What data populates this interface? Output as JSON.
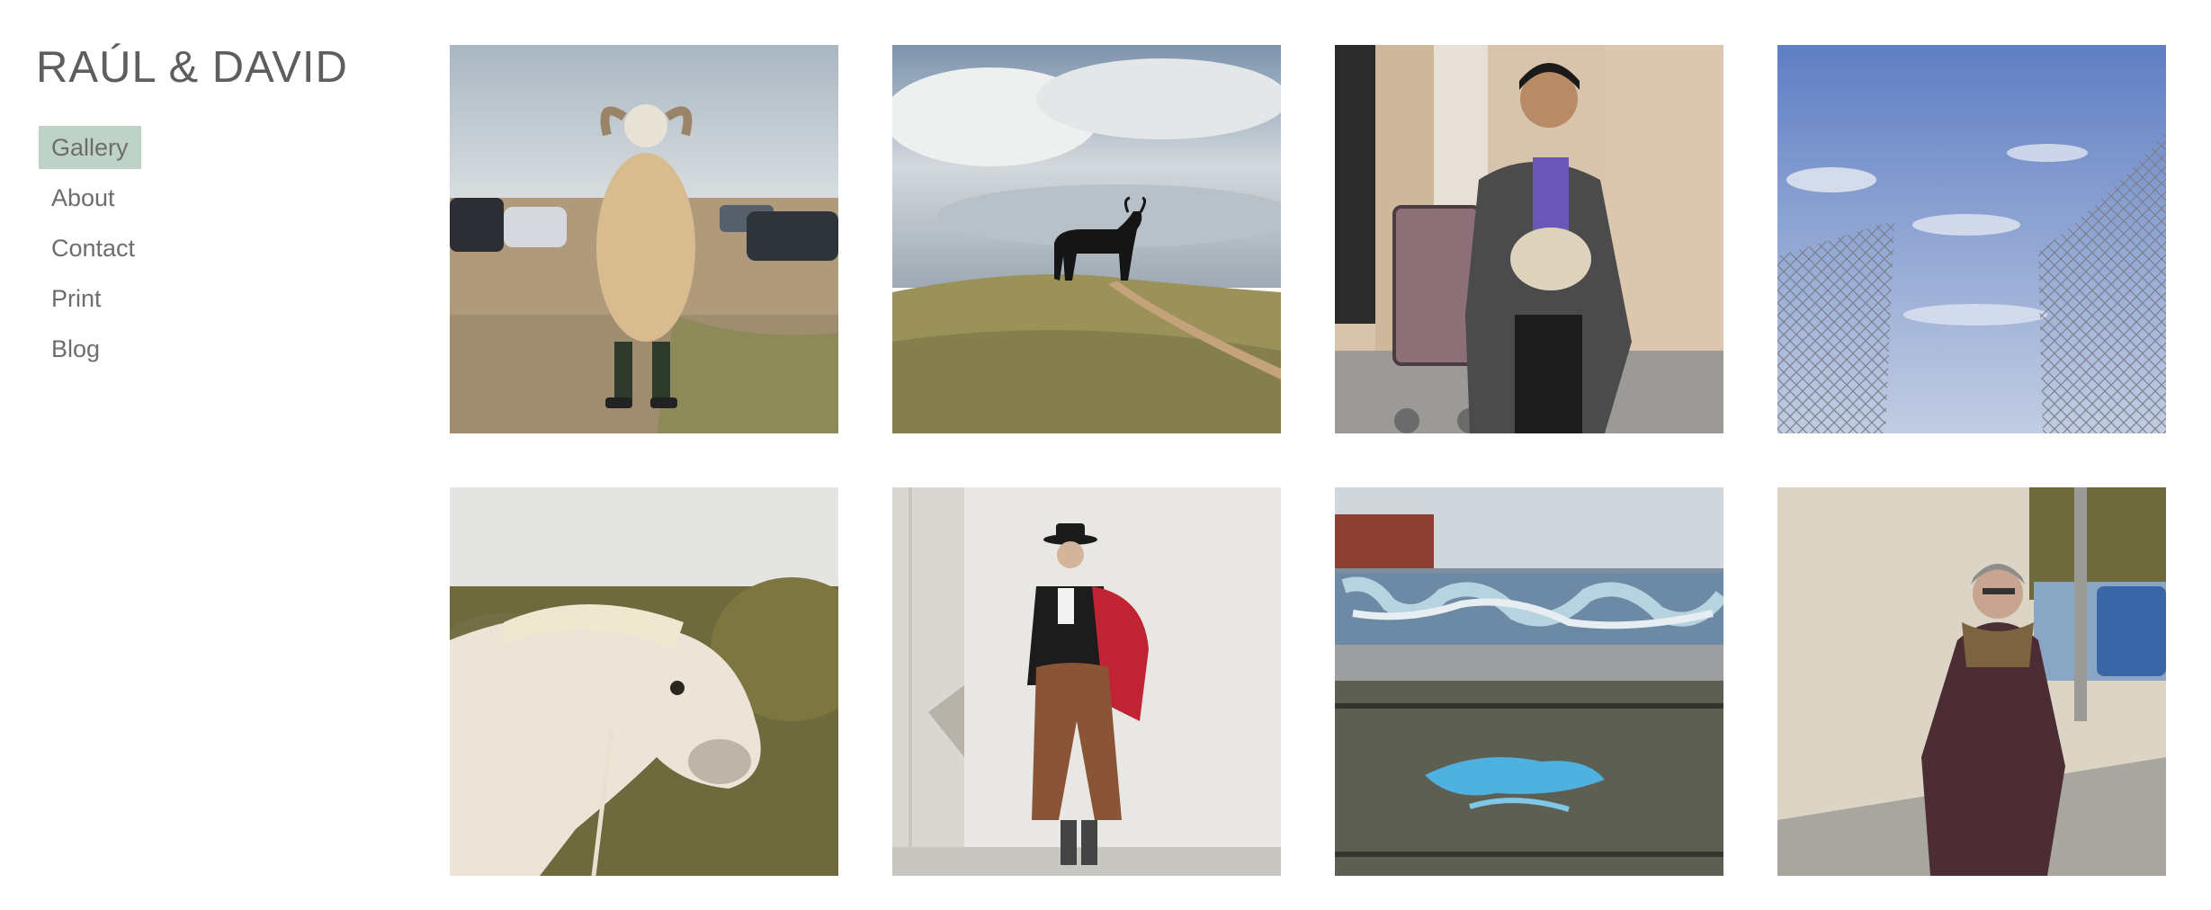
{
  "site": {
    "title": "RAÚL & DAVID"
  },
  "nav": {
    "items": [
      {
        "label": "Gallery",
        "active": true
      },
      {
        "label": "About",
        "active": false
      },
      {
        "label": "Contact",
        "active": false
      },
      {
        "label": "Print",
        "active": false
      },
      {
        "label": "Blog",
        "active": false
      }
    ]
  },
  "colors": {
    "nav_active_bg": "#bfd2c8",
    "text": "#666666"
  },
  "gallery": {
    "photos": [
      {
        "subject": "person in sheepskin costume with ram horns in a parking lot"
      },
      {
        "subject": "black bull silhouette billboard on a grassy hill under clouds"
      },
      {
        "subject": "woman holding a bag of garlic beside a shopping trolley"
      },
      {
        "subject": "torn chain-link fence against a blue sky"
      },
      {
        "subject": "white pony grazing near a hedge"
      },
      {
        "subject": "young man in traditional Spanish riding outfit with red cape"
      },
      {
        "subject": "graffiti wall beside railway tracks with blue paint splash"
      },
      {
        "subject": "older woman in leather coat on a street near a blue bus"
      }
    ]
  }
}
